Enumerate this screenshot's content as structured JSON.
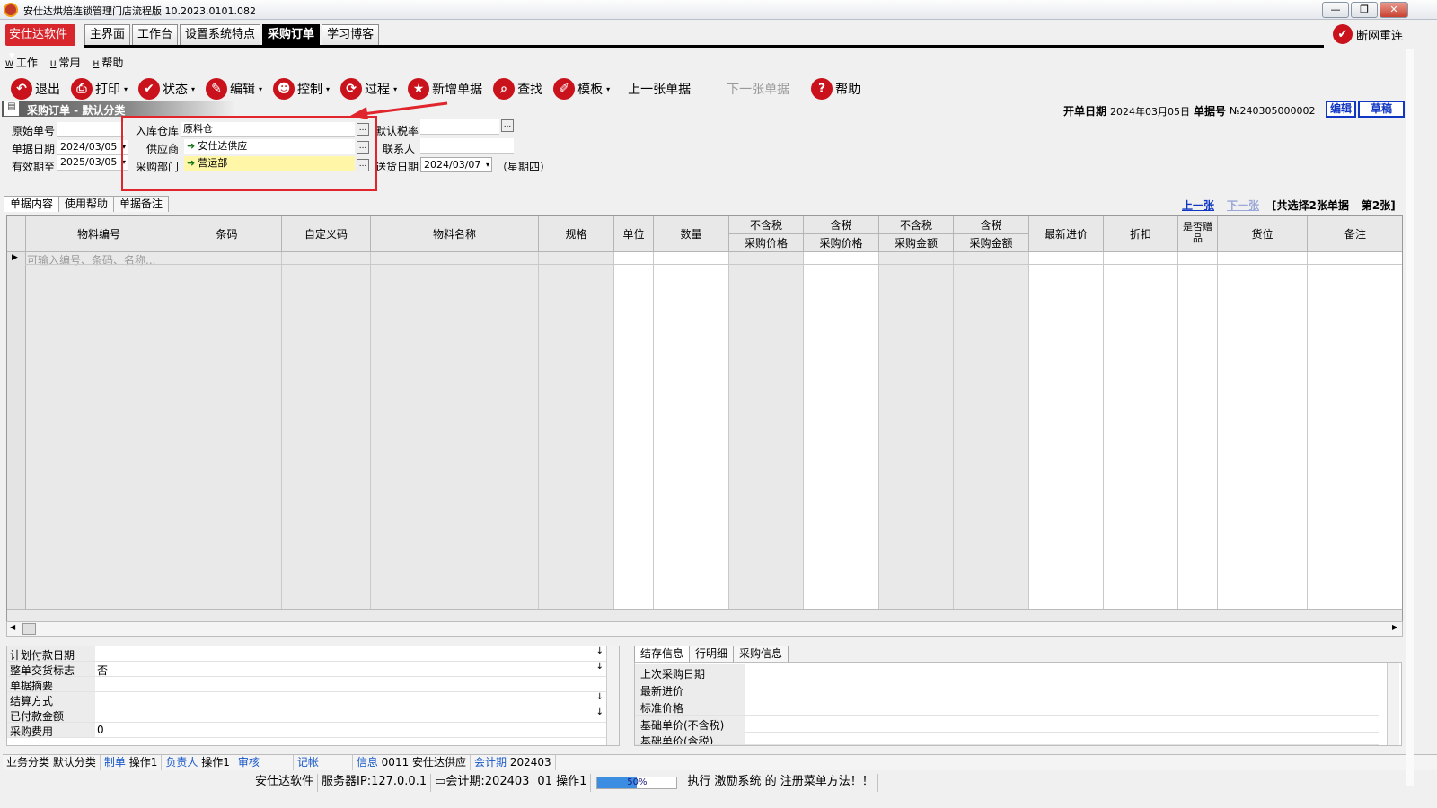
{
  "window": {
    "title": "安仕达烘焙连锁管理门店流程版   10.2023.0101.082",
    "min": "—",
    "max": "❐",
    "close": "✕"
  },
  "brand_button": "安仕达软件 ▾",
  "main_tabs": [
    "主界面",
    "工作台",
    "设置系统特点",
    "采购订单",
    "学习博客"
  ],
  "reconnect": {
    "label": "断网重连",
    "icon": "✔"
  },
  "menu": [
    {
      "key": "W",
      "label": "工作"
    },
    {
      "key": "U",
      "label": "常用"
    },
    {
      "key": "H",
      "label": "帮助"
    }
  ],
  "toolbar": [
    {
      "icon": "↶",
      "label": "退出"
    },
    {
      "icon": "⎙",
      "label": "打印",
      "caret": "▾"
    },
    {
      "icon": "✔",
      "label": "状态",
      "caret": "▾"
    },
    {
      "icon": "✎",
      "label": "编辑",
      "caret": "▾"
    },
    {
      "icon": "☻",
      "label": "控制",
      "caret": "▾"
    },
    {
      "icon": "⟳",
      "label": "过程",
      "caret": "▾"
    },
    {
      "icon": "★",
      "label": "新增单据"
    },
    {
      "icon": "⌕",
      "label": "查找"
    },
    {
      "icon": "✐",
      "label": "模板",
      "caret": "▾"
    },
    {
      "label": "上一张单据"
    },
    {
      "label": "下一张单据"
    },
    {
      "icon": "?",
      "label": "帮助"
    }
  ],
  "doc_header": {
    "band_title": "采购订单 - 默认分类",
    "open_date_label": "开单日期",
    "open_date": "2024年03月05日",
    "doc_no_label": "单据号",
    "doc_no": "№240305000002",
    "edit_btn": "编辑",
    "draft_btn": "草稿"
  },
  "form": {
    "orig_no_label": "原始单号",
    "orig_no": "",
    "doc_date_label": "单据日期",
    "doc_date": "2024/03/05",
    "valid_until_label": "有效期至",
    "valid_until": "2025/03/05",
    "warehouse_label": "入库仓库",
    "warehouse": "原料仓",
    "supplier_label": "供应商",
    "supplier": "安仕达供应",
    "dept_label": "采购部门",
    "dept": "营运部",
    "tax_label": "默认税率",
    "tax": "",
    "contact_label": "联系人",
    "contact": "",
    "delivery_label": "送货日期",
    "delivery": "2024/03/07",
    "weekday": "（星期四）",
    "ellipsis": "...",
    "dd": "▾"
  },
  "sub_tabs": [
    "单据内容",
    "使用帮助",
    "单据备注"
  ],
  "nav": {
    "prev": "上一张",
    "next": "下一张",
    "summary": "[共选择2张单据",
    "position": "第2张]"
  },
  "grid": {
    "columns": [
      "物料编号",
      "条码",
      "自定义码",
      "物料名称",
      "规格",
      "单位",
      "数量",
      "不含税",
      "含税",
      "不含税",
      "含税",
      "最新进价",
      "折扣",
      "是否赠品",
      "货位",
      "备注"
    ],
    "sub_headers": [
      "采购价格",
      "采购价格",
      "采购金额",
      "采购金额"
    ],
    "entry_placeholder": "可输入编号、条码、名称..."
  },
  "bottom_left": [
    {
      "label": "计划付款日期",
      "value": "",
      "dl": "↓"
    },
    {
      "label": "整单交货标志",
      "value": "否",
      "dl": "↓"
    },
    {
      "label": "单据摘要",
      "value": "",
      "dl": ""
    },
    {
      "label": "结算方式",
      "value": "",
      "dl": "↓"
    },
    {
      "label": "已付款金额",
      "value": "",
      "dl": "↓"
    },
    {
      "label": "采购费用",
      "value": "0",
      "dl": ""
    }
  ],
  "bottom_right_tabs": [
    "结存信息",
    "行明细",
    "采购信息"
  ],
  "bottom_right": [
    "上次采购日期",
    "最新进价",
    "标准价格",
    "基础单价(不含税)",
    "基础单价(含税)"
  ],
  "status1": {
    "category_label": "业务分类",
    "category": "默认分类",
    "maker_label": "制单",
    "maker": "操作1",
    "owner_label": "负责人",
    "owner": "操作1",
    "audit_label": "审核",
    "audit": "",
    "post_label": "记帐",
    "post": "",
    "info_label": "信息",
    "info": "0011  安仕达供应",
    "period_label": "会计期",
    "period": "202403"
  },
  "status2": {
    "company": "安仕达软件",
    "server": "服务器IP:127.0.0.1",
    "period": "会计期:202403",
    "user": "01  操作1",
    "progress": 50,
    "progress_text": "50%",
    "message": "执行 激励系统 的 注册菜单方法！！"
  }
}
